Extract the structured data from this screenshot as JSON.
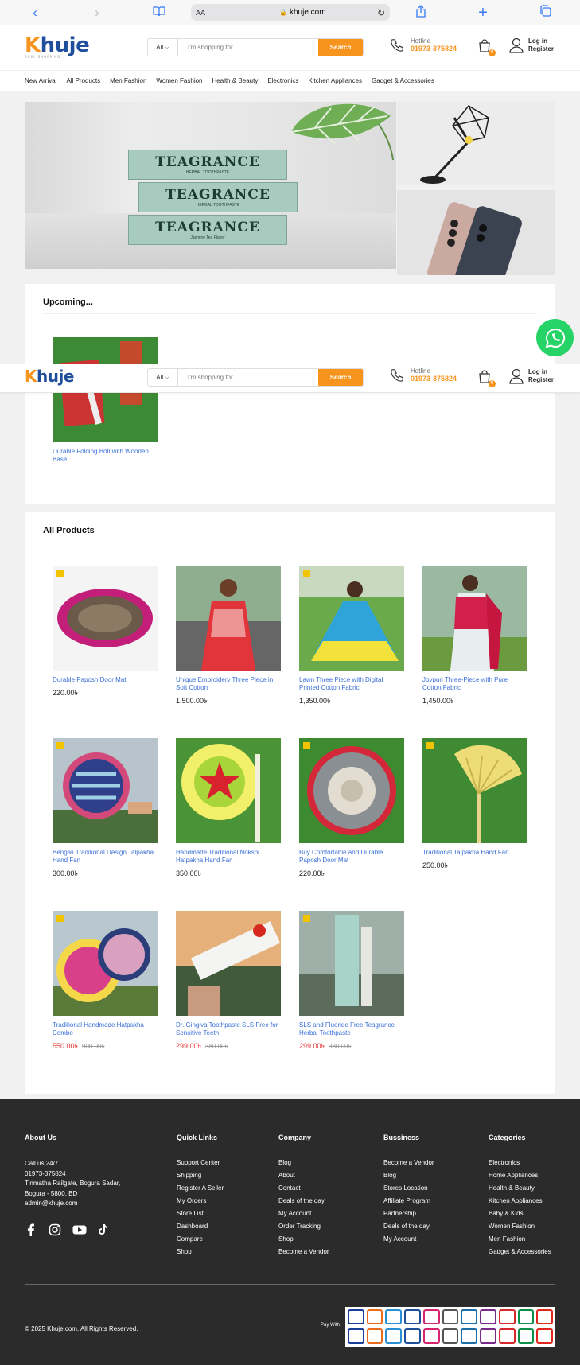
{
  "browser": {
    "url_domain": "khuje.com",
    "text_size_label": "AA"
  },
  "site": {
    "logo_k": "K",
    "logo_rest": "huje",
    "logo_tagline": "EASY SHOPPING"
  },
  "search": {
    "category": "All",
    "placeholder": "I'm shopping for...",
    "button": "Search"
  },
  "hotline": {
    "label": "Hotline",
    "number": "01973-375824"
  },
  "cart": {
    "count": "0"
  },
  "account": {
    "login": "Log in",
    "register": "Register"
  },
  "nav": [
    "New Arrival",
    "All Products",
    "Men Fashion",
    "Women Fashion",
    "Health & Beauty",
    "Electronics",
    "Kitchen Appliances",
    "Gadget & Accessories"
  ],
  "banner": {
    "brand": "TEAGRANCE",
    "subtitle": "HERBAL TOOTHPASTE",
    "tag": "Jasmine Tea Flavor"
  },
  "upcoming": {
    "title": "Upcoming...",
    "items": [
      {
        "name": "Durable Folding Boti with Wooden Base"
      }
    ]
  },
  "all_products": {
    "title": "All Products",
    "items": [
      {
        "name": "Durable Paposh Door Mat",
        "price": "220.00৳",
        "old_price": ""
      },
      {
        "name": "Unique Embroidery Three Piece in Soft Cotton",
        "price": "1,500.00৳",
        "old_price": ""
      },
      {
        "name": "Lawn Three Piece with Digital Printed Cotton Fabric",
        "price": "1,350.00৳",
        "old_price": ""
      },
      {
        "name": "Joypuri Three-Piece with Pure Cotton Fabric",
        "price": "1,450.00৳",
        "old_price": ""
      },
      {
        "name": "Bengali Traditional Design Talpakha Hand Fan",
        "price": "300.00৳",
        "old_price": ""
      },
      {
        "name": "Handmade Traditional Nokshi Hatpakha Hand Fan",
        "price": "350.00৳",
        "old_price": ""
      },
      {
        "name": "Buy Comfortable and Durable Paposh Door Mat",
        "price": "220.00৳",
        "old_price": ""
      },
      {
        "name": "Traditional Talpakha Hand Fan",
        "price": "250.00৳",
        "old_price": ""
      },
      {
        "name": "Traditional Handmade Hatpakha Combo",
        "price": "550.00৳",
        "old_price": "900.00৳"
      },
      {
        "name": "Dr. Gingiva Toothpaste SLS Free for Sensitive Teeth",
        "price": "299.00৳",
        "old_price": "380.00৳"
      },
      {
        "name": "SLS and Fluoride Free Teagrance Herbal Toothpaste",
        "price": "299.00৳",
        "old_price": "380.00৳"
      }
    ]
  },
  "footer": {
    "about": {
      "title": "About Us",
      "call": "Call us 24/7",
      "phone": "01973-375824",
      "address1": "Tinmatha Railgate, Bogura Sadar,",
      "address2": "Bogura - 5800, BD",
      "email": "admin@khuje.com"
    },
    "quick_links": {
      "title": "Quick Links",
      "items": [
        "Support Center",
        "Shipping",
        "Register A Seller",
        "My Orders",
        "Store List",
        "Dashboard",
        "Compare",
        "Shop"
      ]
    },
    "company": {
      "title": "Company",
      "items": [
        "Blog",
        "About",
        "Contact",
        "Deals of the day",
        "My Account",
        "Order Tracking",
        "Shop",
        "Become a Vendor"
      ]
    },
    "business": {
      "title": "Bussiness",
      "items": [
        "Become a Vendor",
        "Blog",
        "Stores Location",
        "Affiliate Program",
        "Partnership",
        "Deals of the day",
        "My Account"
      ]
    },
    "categories": {
      "title": "Categories",
      "items": [
        "Electronics",
        "Home Appliances",
        "Health & Beauty",
        "Kitchen Appliances",
        "Baby & Kids",
        "Women Fashion",
        "Men Fashion",
        "Gadget & Accessories"
      ]
    },
    "copyright": "© 2025 Khuje.com. All Rights Reserved.",
    "pay_with": "Pay With",
    "payment_methods": [
      "VISA",
      "Mastercard",
      "Amex",
      "DBBL",
      "bKash",
      "Nexus",
      "UnionPay",
      "Rocket",
      "Upay",
      "Islami",
      "BRAC",
      "Nagad",
      "iPay",
      "SureCash",
      "Cellfin",
      "MyCash",
      "OK",
      "Trust",
      "Tap",
      "FirstCash",
      "Meghna",
      "Prime"
    ]
  },
  "colors": {
    "accent": "#f7941d",
    "link": "#3a6fd8",
    "sale": "#e53935",
    "footer_bg": "#2b2b2b"
  }
}
